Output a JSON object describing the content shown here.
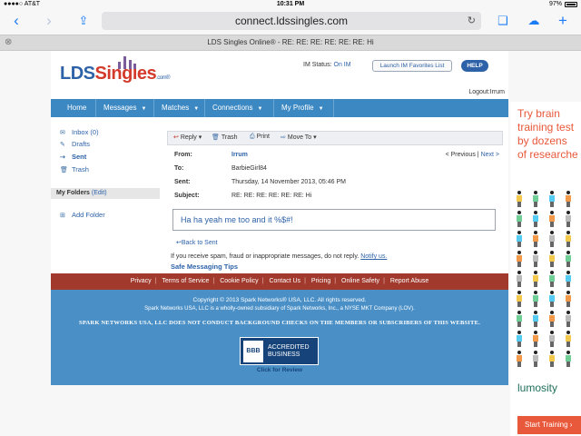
{
  "status_bar": {
    "carrier": "●●●●○ AT&T",
    "time": "10:31 PM",
    "battery": "97%"
  },
  "browser": {
    "url": "connect.ldssingles.com",
    "tab_title": "LDS Singles Online® - RE: RE: RE: RE: RE: RE: Hi",
    "icons": [
      "back-icon",
      "forward-icon",
      "share-icon",
      "reload-icon",
      "bookmarks-icon",
      "cloud-icon",
      "new-tab-icon",
      "close-tab-icon"
    ]
  },
  "site": {
    "logo_main": "LDS",
    "logo_accent": "Singles",
    "logo_suffix": ".com®",
    "im_status_label": "IM Status:",
    "im_status_value": "On IM",
    "im_button": "Launch IM Favorites List",
    "help_button": "HELP",
    "logout": "Logout:Irrum",
    "nav": [
      "Home",
      "Messages",
      "Matches",
      "Connections",
      "My Profile"
    ]
  },
  "sidebar": {
    "items": [
      {
        "label": "Inbox (0)",
        "icon": "inbox-icon"
      },
      {
        "label": "Drafts",
        "icon": "drafts-icon"
      },
      {
        "label": "Sent",
        "icon": "sent-icon"
      },
      {
        "label": "Trash",
        "icon": "trash-icon"
      }
    ],
    "folders_title": "My Folders",
    "folders_edit": "(Edit)",
    "add_folder": "Add Folder"
  },
  "message": {
    "toolbar": {
      "reply": "Reply",
      "trash": "Trash",
      "print": "Print",
      "move_to": "Move To"
    },
    "prev": "< Previous",
    "next": "Next >",
    "labels": {
      "from": "From:",
      "to": "To:",
      "sent": "Sent:",
      "subject": "Subject:"
    },
    "from": "Irrum",
    "to": "BarbieGirl84",
    "sent": "Thursday, 14 November 2013, 05:46 PM",
    "subject": "RE: RE: RE: RE: RE: RE: Hi",
    "body": "Ha ha yeah me too and it %$#!",
    "back_link": "Back to Sent",
    "spam_note": "If you receive spam, fraud or inappropriate messages, do not reply.",
    "notify": "Notify us.",
    "safe_tips": "Safe Messaging Tips"
  },
  "footer": {
    "links": [
      "Privacy",
      "Terms of Service",
      "Cookie Policy",
      "Contact Us",
      "Pricing",
      "Online Safety",
      "Report Abuse"
    ],
    "copyright": "Copyright © 2013 Spark Networks® USA, LLC. All rights reserved.",
    "subsidiary": "Spark Networks USA, LLC is a wholly-owned subsidiary of Spark Networks, Inc., a NYSE MKT Company (LOV).",
    "notice": "SPARK NETWORKS USA, LLC DOES NOT CONDUCT BACKGROUND CHECKS ON THE MEMBERS OR SUBSCRIBERS OF THIS WEBSITE.",
    "bbb_seal": "BBB",
    "bbb_line1": "ACCREDITED",
    "bbb_line2": "BUSINESS",
    "bbb_click": "Click for Review"
  },
  "ad": {
    "headline": [
      "Try brain",
      "training test",
      "by dozens",
      "of researche"
    ],
    "brand": "lumosity",
    "cta": "Start Training ›"
  }
}
